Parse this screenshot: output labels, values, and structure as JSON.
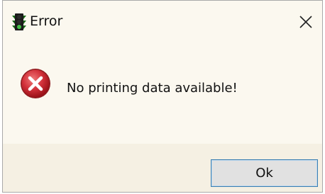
{
  "window": {
    "title": "Error",
    "icon": "traffic-light-icon",
    "close_icon": "close-icon"
  },
  "message": {
    "icon": "error-icon",
    "text": "No printing data available!"
  },
  "buttons": {
    "ok_label": "Ok"
  },
  "colors": {
    "dialog_background": "#fbf8ef",
    "error_red": "#c9262e",
    "button_border": "#3c7fb1"
  }
}
